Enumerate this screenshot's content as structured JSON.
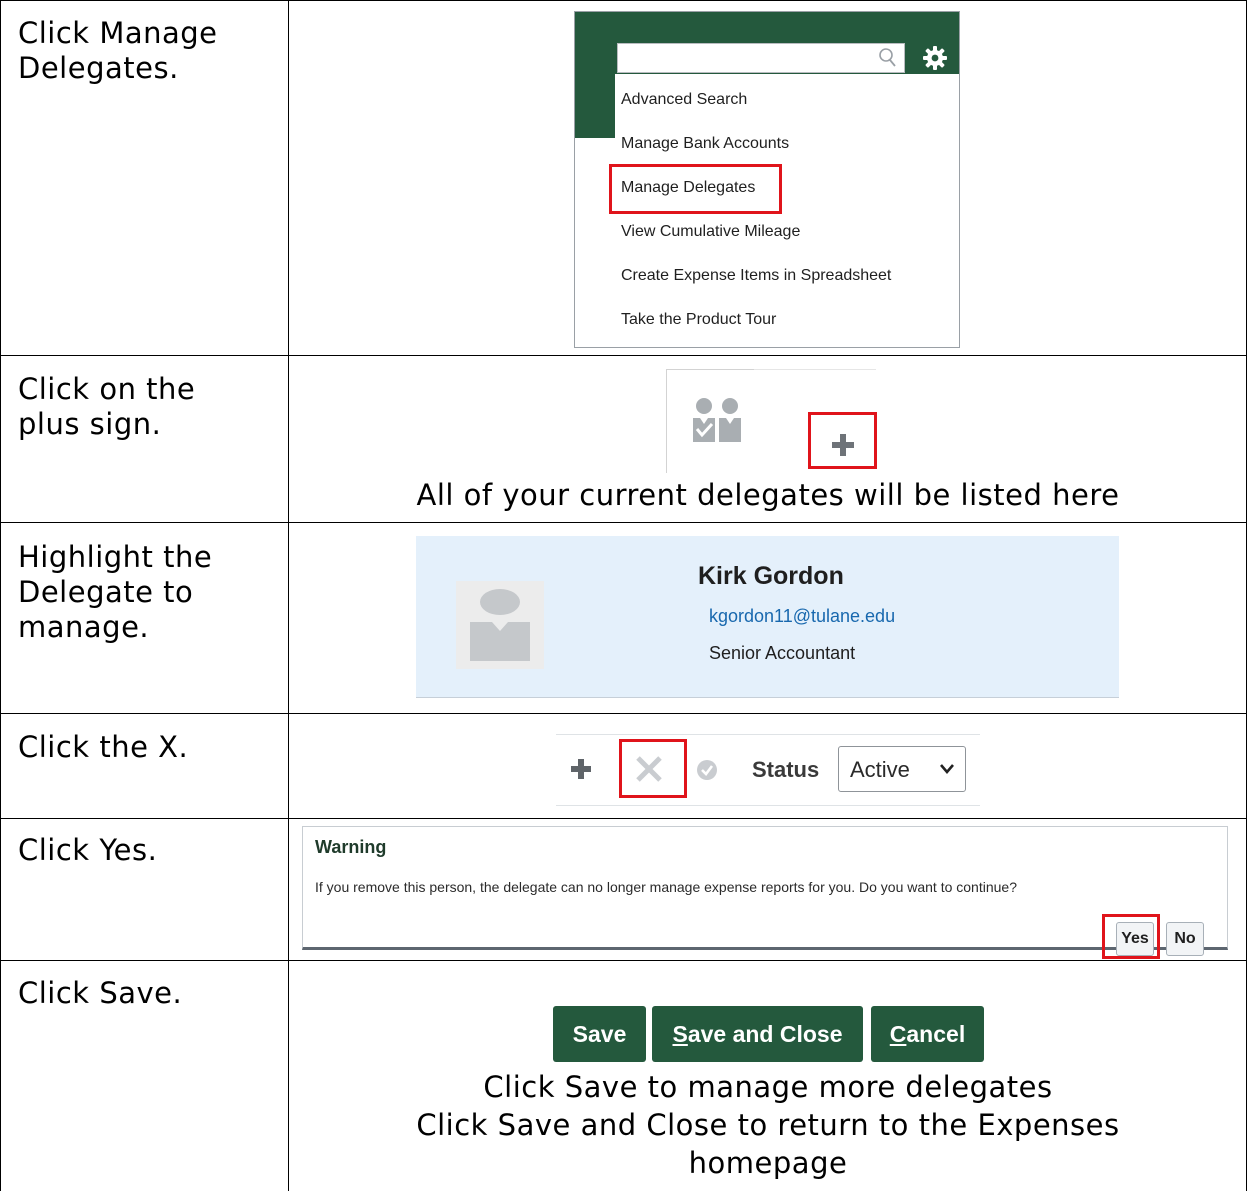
{
  "steps": [
    {
      "instruction": "Click Manage\nDelegates."
    },
    {
      "instruction": "Click on the\nplus sign."
    },
    {
      "instruction": "Highlight the\nDelegate to\nmanage."
    },
    {
      "instruction": "Click the X."
    },
    {
      "instruction": "Click Yes."
    },
    {
      "instruction": "Click Save."
    }
  ],
  "menu": {
    "search_icon": "search-icon",
    "settings_icon": "gear-icon",
    "items": [
      {
        "label": "Advanced Search"
      },
      {
        "label": "Manage Bank Accounts"
      },
      {
        "label": "Manage Delegates"
      },
      {
        "label": "View Cumulative Mileage"
      },
      {
        "label": "Create Expense Items in Spreadsheet"
      },
      {
        "label": "Take the Product Tour"
      }
    ],
    "highlighted": "Manage Delegates"
  },
  "delegates_panel": {
    "icon": "delegates-icon",
    "add_icon": "plus-icon",
    "caption": "All of your current delegates will be listed here"
  },
  "delegate_card": {
    "name": "Kirk Gordon",
    "email": "kgordon11@tulane.edu",
    "title": "Senior Accountant"
  },
  "toolbar": {
    "status_label": "Status",
    "status_value": "Active"
  },
  "warning": {
    "title": "Warning",
    "message": "If you remove this person, the delegate can no longer manage expense reports for you. Do you want to continue?",
    "yes_label": "Yes",
    "no_label": "No"
  },
  "actions": {
    "save_label": "Save",
    "save_close_first": "S",
    "save_close_rest": "ave and Close",
    "cancel_first": "C",
    "cancel_rest": "ancel",
    "note_1": "Click Save to manage more delegates",
    "note_2": "Click Save and Close to return to the Expenses",
    "note_3": "homepage"
  },
  "colors": {
    "brand_green": "#24593d",
    "highlight_red": "#e0141b",
    "card_blue": "#e4f0fb",
    "link_blue": "#1868ae"
  }
}
